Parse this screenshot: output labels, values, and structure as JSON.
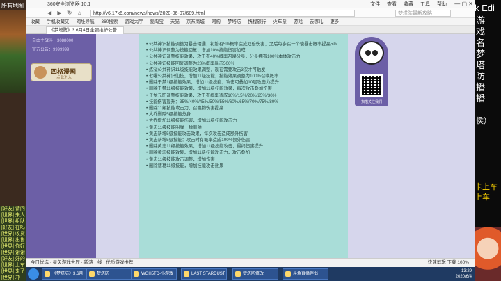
{
  "left_strip": {
    "top_label": "所有地图",
    "chat_lines": [
      "[好友] 请问",
      "[世界] 来人",
      "[世界] 组队",
      "[好友] 在吗",
      "[世界] 收货",
      "[世界] 出售",
      "[世界] 你好",
      "[世界] 谢谢",
      "[好友] 好的",
      "[世界] 上车",
      "[世界] 来了",
      "[世界] 冲"
    ]
  },
  "right_strip": {
    "title": "k Edi",
    "sub_lines": [
      "游",
      "戏",
      "名",
      "梦",
      "塔",
      "防"
    ],
    "mid_lines": [
      "播",
      "播"
    ],
    "tag": "侯）",
    "yellow_lines": [
      "卡上车",
      "上车"
    ]
  },
  "browser": {
    "title": "360安全浏览器 10.1",
    "menu": [
      "文件",
      "查看",
      "收藏",
      "工具",
      "帮助"
    ],
    "logo": "e",
    "nav": [
      "◀",
      "▶",
      "↻",
      "⌂"
    ],
    "url": "http://v6.17k6.com/news/news/2020-06-07/689.html",
    "search_placeholder": "梦塔防最新攻略",
    "bookmarks": [
      "收藏",
      "手机收藏夹",
      "网址导航",
      "360搜索",
      "游戏大厅",
      "爱淘宝",
      "天猫",
      "京东商城",
      "网购",
      "梦塔防",
      "携程旅行",
      "火车票",
      "游戏",
      "去哪儿",
      "更多"
    ],
    "tab_label": "《梦塔防》3.6月4日全服维护公告"
  },
  "left_panel": {
    "lines": [
      "自由主战斗：3088000",
      "官方公告：9999999"
    ],
    "button_label": "四格漫画",
    "button_sub": "点此进入"
  },
  "content_items": [
    "• 公共神识技能调整为暴击精通，初始有5%概率造成双倍伤害，之后每多买一个使暴击概率提高5%",
    "• 公共神识调整为技能回复，增加10%技能伤害加成",
    "• 公共神识调整技能效果，攻击有40%概率召唤分身，分身拥有100%本体攻击力",
    "• 公共神识技能回复调整为20%概率暴击500%",
    "• 炼狱公共神识11级技能效果调整，现在需要攻击3次才可触发",
    "• 七曜公共神识仙技，增加11级技能，技能效果调整为100%召唤概率",
    "• 删除于禁1级技能效果，增加11级技能，攻击可叠加10层攻击力提升",
    "• 删除于禁11级技能效果，增加11级技能效果，每次攻击叠加伤害",
    "• 子龙元阳调整技能效果，攻击有概率造成10%/15%/20%/25%/30%",
    "• 技能伤害提升：35%/40%/45%/50%/55%/60%/65%/70%/75%/80%",
    "• 删除11级技能攻击力，召唤物伤害提高",
    "• 大乔删除5级技能分身",
    "• 大乔增加11级技能伤害，增加11级技能攻击力",
    "• 黄忠11级技能叫弹一弹删除",
    "• 黄忠新增5级技能攻击效果，每次攻击造成额外伤害",
    "• 黄忠新增5级技能：攻击时有概率造成100%额外伤害",
    "• 删除黄忠11级技能效果，增加11级技能攻击，最终伤害提升",
    "• 删除黄忠技能效果，增加11级技能攻击力，攻击叠加",
    "• 黄忠11级技能攻击调整，增加伤害",
    "• 删除诸葛11级技能，增加技能攻击效果"
  ],
  "widget": {
    "caption": "扫描关注我们"
  },
  "statusbar": {
    "left": "今日优选  ·  星矢游戏大厅  ·  新游上线  ·  优质游戏推荐",
    "right": "快速剪辑    下载    100%"
  },
  "taskbar": {
    "tasks": [
      "《梦塔防》3.6月",
      "梦塔防",
      "WGH5TD-小游戏",
      "LAST STARDUST",
      "梦塔防修改",
      "斗鱼直播伴侣"
    ],
    "time": "13:29",
    "date": "2020/6/4"
  },
  "colors": {
    "content_bg": "#a9ddd8",
    "panel_purple": "#6c5fa6",
    "taskbar": "#1f3a62"
  }
}
